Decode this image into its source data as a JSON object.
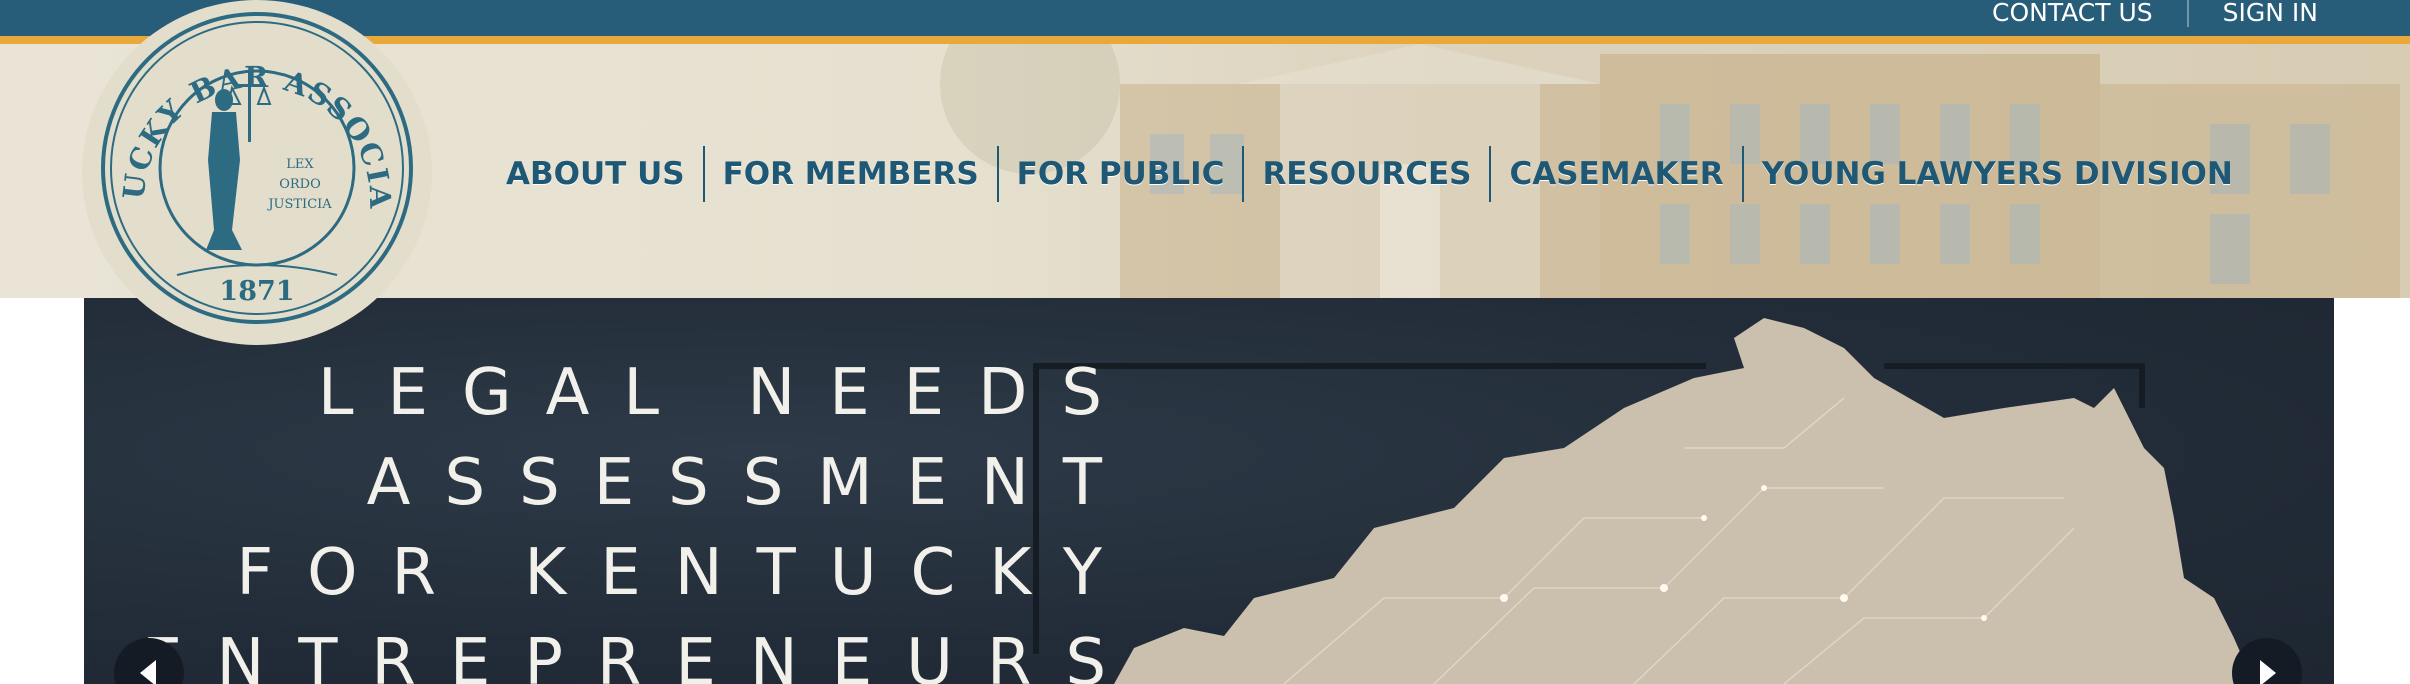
{
  "utility_nav": {
    "contact": "CONTACT US",
    "signin": "SIGN IN"
  },
  "logo": {
    "org_name": "KENTUCKY BAR ASSOCIATION",
    "motto": [
      "LEX",
      "ORDO",
      "JUSTICIA"
    ],
    "year": "1871"
  },
  "main_nav": {
    "items": [
      {
        "label": "ABOUT US"
      },
      {
        "label": "FOR MEMBERS"
      },
      {
        "label": "FOR PUBLIC"
      },
      {
        "label": "RESOURCES"
      },
      {
        "label": "CASEMAKER"
      },
      {
        "label": "YOUNG LAWYERS DIVISION"
      }
    ]
  },
  "hero": {
    "lines": [
      "LEGAL NEEDS",
      "ASSESSMENT",
      "FOR KENTUCKY",
      "ENTREPRENEURS"
    ],
    "prev_icon": "chevron-left-icon",
    "next_icon": "chevron-right-icon"
  },
  "colors": {
    "topbar": "#275d78",
    "accent_stripe": "#e8a93a",
    "nav_text": "#1f5874",
    "hero_bg": "#222c38",
    "map_fill": "#cbbfae"
  }
}
